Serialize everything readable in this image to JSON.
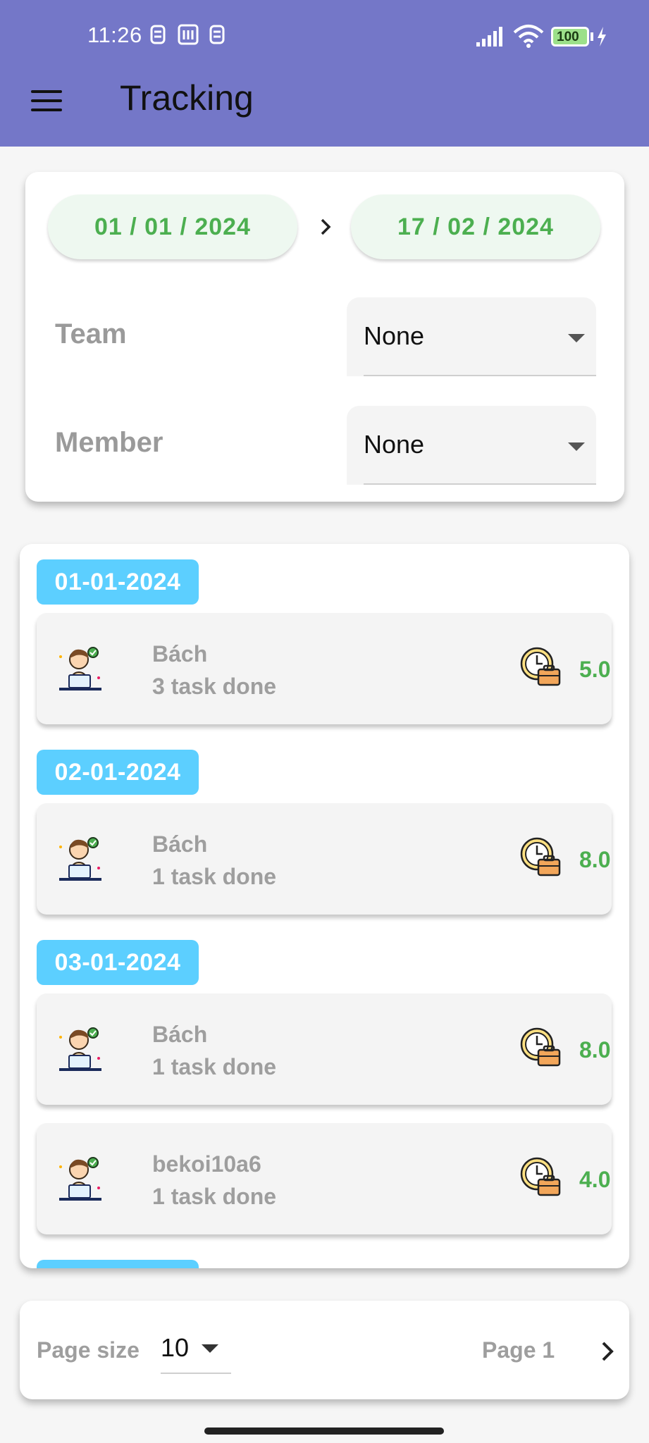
{
  "status_bar": {
    "time": "11:26",
    "battery": "100"
  },
  "app_bar": {
    "title": "Tracking",
    "menu_icon": "hamburger-menu-icon"
  },
  "filter": {
    "start_date": "01 / 01 / 2024",
    "end_date": "17 / 02 / 2024",
    "team_label": "Team",
    "team_value": "None",
    "member_label": "Member",
    "member_value": "None"
  },
  "groups": [
    {
      "date": "01-01-2024",
      "entries": [
        {
          "name": "Bách",
          "tasks": "3 task done",
          "hours": "5.0"
        }
      ]
    },
    {
      "date": "02-01-2024",
      "entries": [
        {
          "name": "Bách",
          "tasks": "1 task done",
          "hours": "8.0"
        }
      ]
    },
    {
      "date": "03-01-2024",
      "entries": [
        {
          "name": "Bách",
          "tasks": "1 task done",
          "hours": "8.0"
        },
        {
          "name": "bekoi10a6",
          "tasks": "1 task done",
          "hours": "4.0"
        }
      ]
    }
  ],
  "pagination": {
    "page_size_label": "Page size",
    "page_size_value": "10",
    "page_label": "Page 1"
  },
  "colors": {
    "app_bar": "#7477c8",
    "date_chip": "#5ccfff",
    "accent_green": "#4caf50"
  }
}
